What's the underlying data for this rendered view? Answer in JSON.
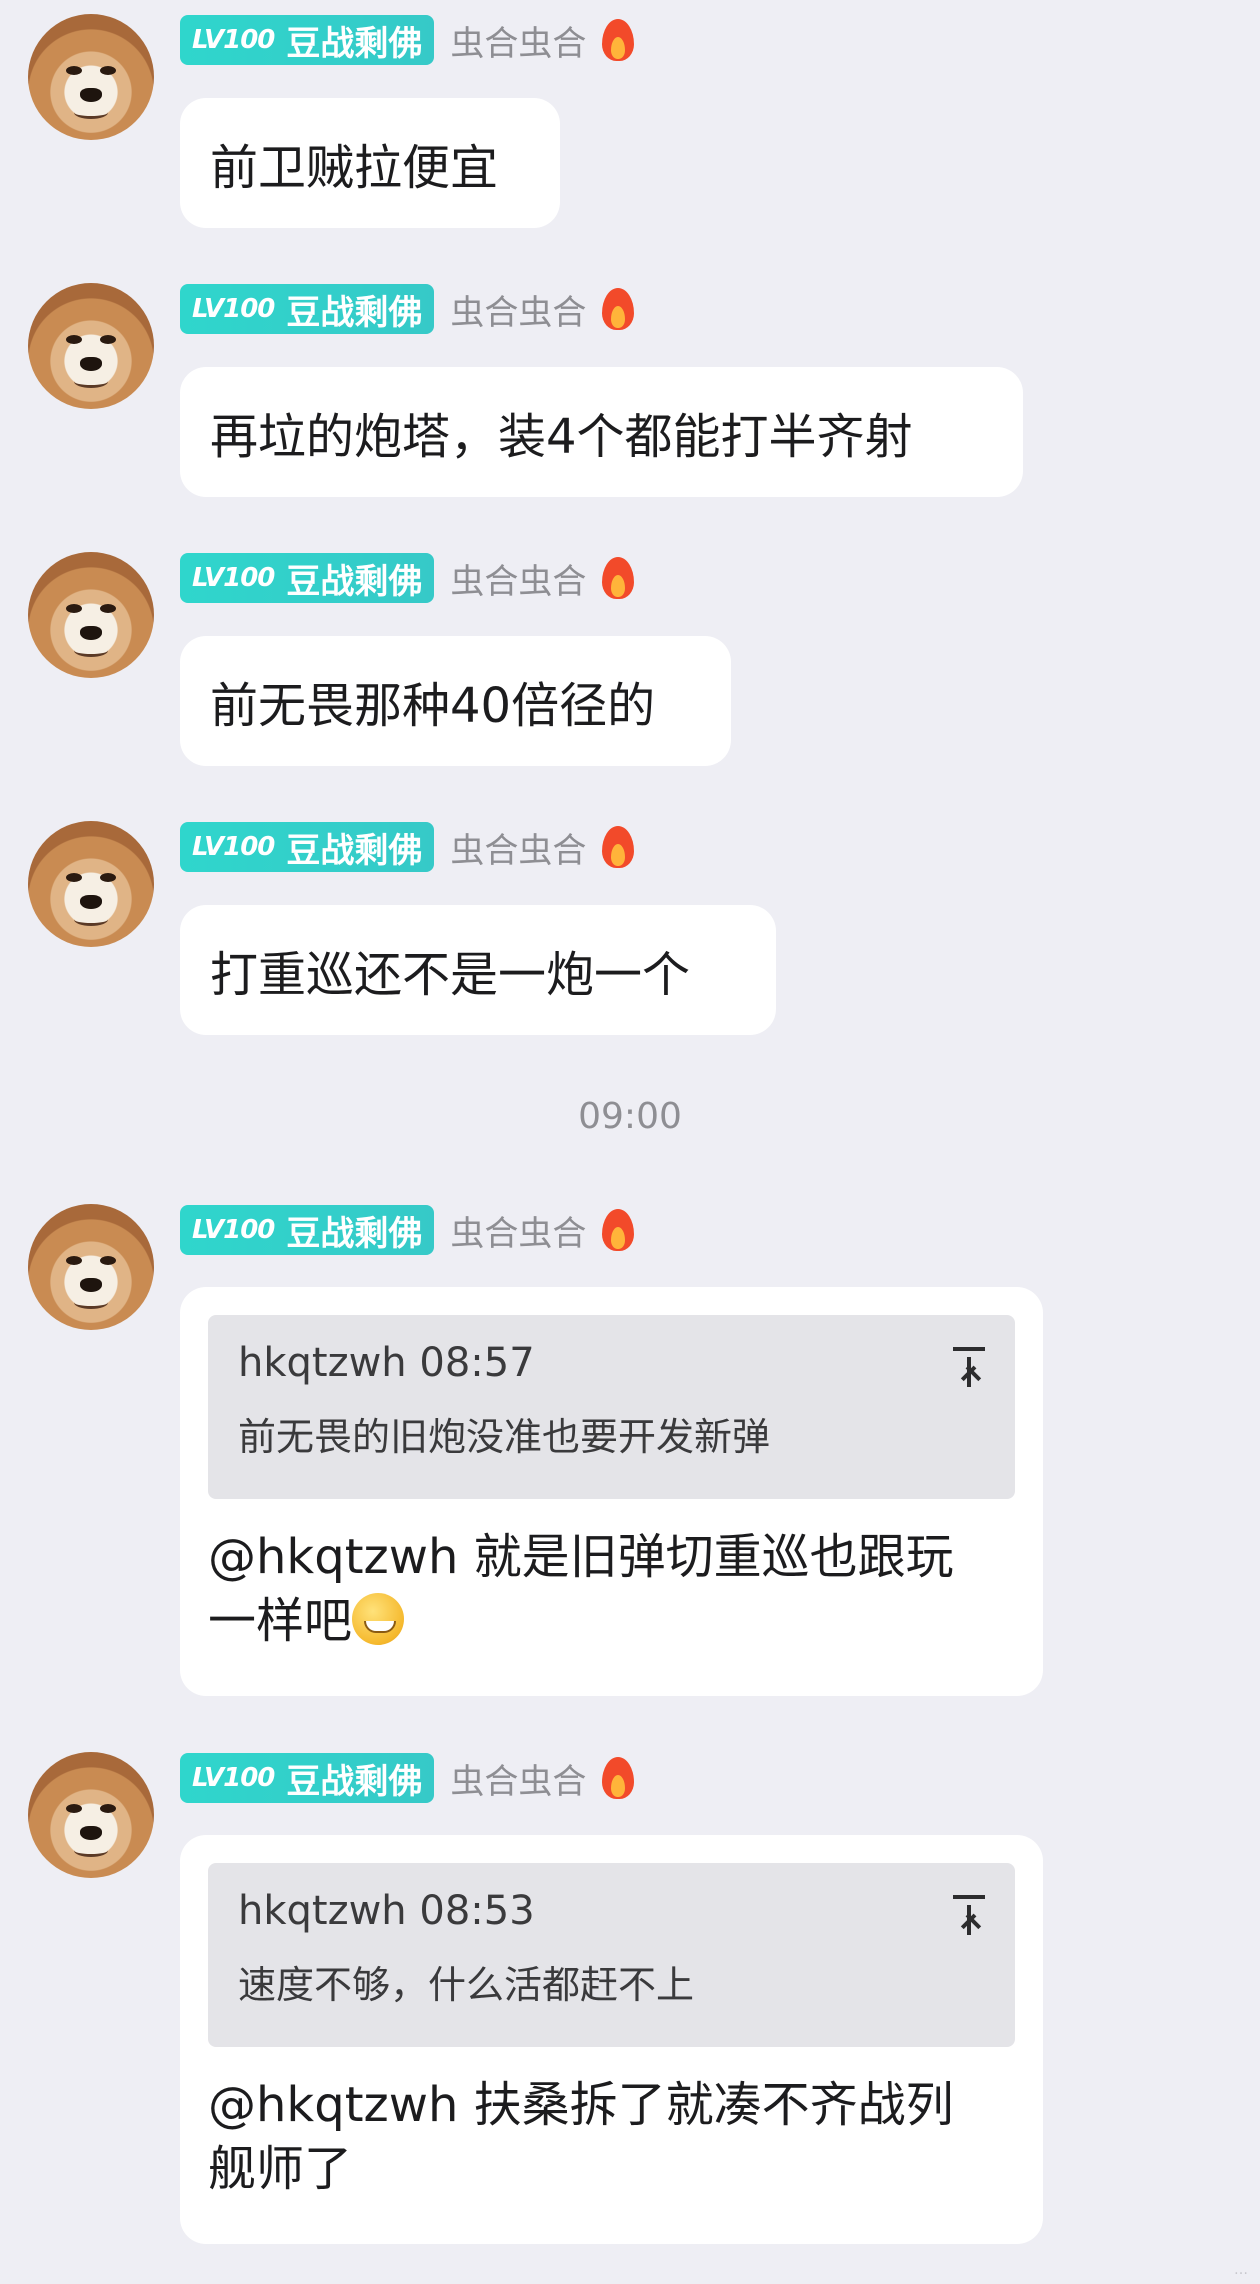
{
  "time_divider": "09:00",
  "corner_watermark": "…",
  "messages": [
    {
      "badge_lv": "LV100",
      "badge_title": "豆战剩佛",
      "username": "虫合虫合",
      "text": "前卫贼拉便宜"
    },
    {
      "badge_lv": "LV100",
      "badge_title": "豆战剩佛",
      "username": "虫合虫合",
      "text": "再垃的炮塔，装4个都能打半齐射"
    },
    {
      "badge_lv": "LV100",
      "badge_title": "豆战剩佛",
      "username": "虫合虫合",
      "text": "前无畏那种40倍径的"
    },
    {
      "badge_lv": "LV100",
      "badge_title": "豆战剩佛",
      "username": "虫合虫合",
      "text": "打重巡还不是一炮一个"
    },
    {
      "badge_lv": "LV100",
      "badge_title": "豆战剩佛",
      "username": "虫合虫合",
      "quote_head": "hkqtzwh 08:57",
      "quote_body": "前无畏的旧炮没准也要开发新弹",
      "reply_line1": "@hkqtzwh 就是旧弹切重巡也跟玩",
      "reply_line2": "一样吧"
    },
    {
      "badge_lv": "LV100",
      "badge_title": "豆战剩佛",
      "username": "虫合虫合",
      "quote_head": "hkqtzwh 08:53",
      "quote_body": "速度不够，什么活都赶不上",
      "reply_line1": "@hkqtzwh 扶桑拆了就凑不齐战列",
      "reply_line2": "舰师了"
    }
  ]
}
